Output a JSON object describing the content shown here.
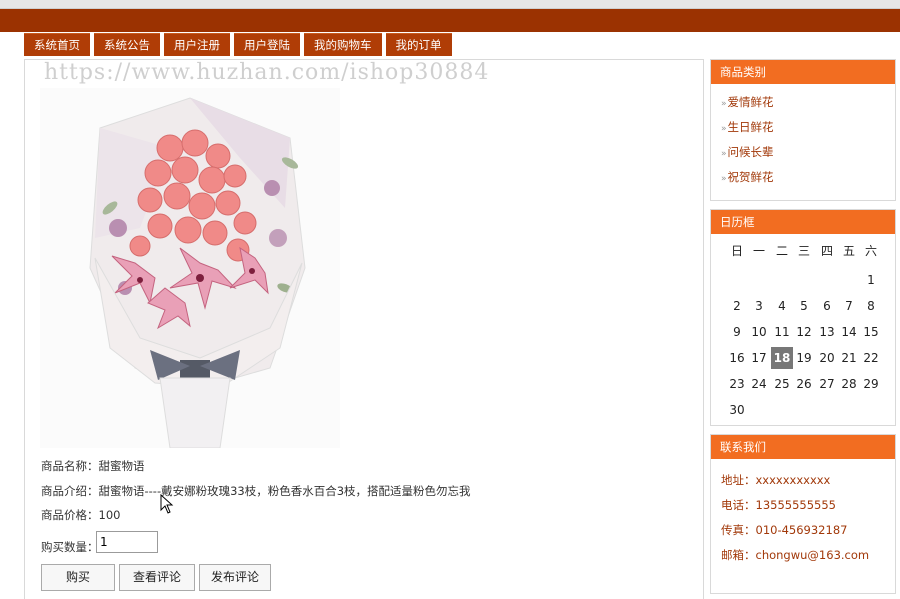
{
  "nav": {
    "items": [
      "系统首页",
      "系统公告",
      "用户注册",
      "用户登陆",
      "我的购物车",
      "我的订单"
    ]
  },
  "watermark": "https://www.huzhan.com/ishop30884",
  "product": {
    "name_line": "商品名称：甜蜜物语",
    "desc_line": "商品介绍：甜蜜物语----戴安娜粉玫瑰33枝，粉色香水百合3枝，搭配适量粉色勿忘我",
    "price_line": "商品价格：100",
    "qty_label": "购买数量：",
    "qty_value": "1"
  },
  "buttons": {
    "buy": "购买",
    "view_reviews": "查看评论",
    "post_review": "发布评论"
  },
  "categories": {
    "title": "商品类别",
    "items": [
      "爱情鲜花",
      "生日鲜花",
      "问候长辈",
      "祝贺鲜花"
    ],
    "bullet": "»"
  },
  "calendar": {
    "title": "日历框",
    "weekdays": [
      "日",
      "一",
      "二",
      "三",
      "四",
      "五",
      "六"
    ],
    "weeks": [
      [
        "",
        "",
        "",
        "",
        "",
        "",
        "1"
      ],
      [
        "2",
        "3",
        "4",
        "5",
        "6",
        "7",
        "8"
      ],
      [
        "9",
        "10",
        "11",
        "12",
        "13",
        "14",
        "15"
      ],
      [
        "16",
        "17",
        "18",
        "19",
        "20",
        "21",
        "22"
      ],
      [
        "23",
        "24",
        "25",
        "26",
        "27",
        "28",
        "29"
      ],
      [
        "30",
        "",
        "",
        "",
        "",
        "",
        ""
      ]
    ],
    "today": "18"
  },
  "contact": {
    "title": "联系我们",
    "address": "地址：xxxxxxxxxxx",
    "phone": "电话：13555555555",
    "fax": "传真：010-456932187",
    "email": "邮箱：chongwu@163.com"
  },
  "colors": {
    "banner": "#9b3201",
    "nav_tab": "#b03d06",
    "panel_header": "#f26d21",
    "link": "#a2390a"
  }
}
